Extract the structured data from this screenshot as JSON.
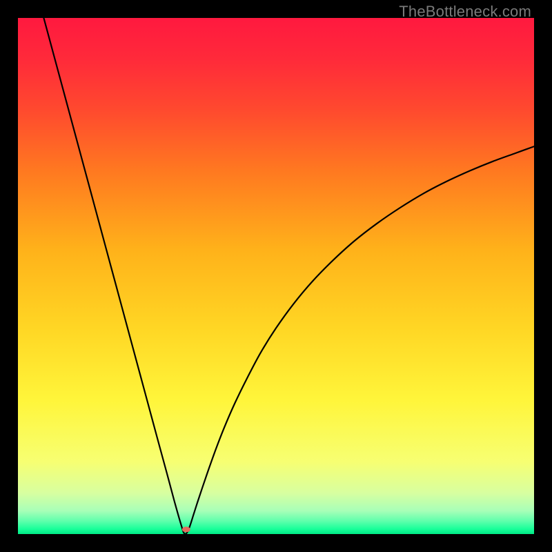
{
  "watermark": "TheBottleneck.com",
  "chart_data": {
    "type": "line",
    "title": "",
    "xlabel": "",
    "ylabel": "",
    "xlim": [
      0,
      100
    ],
    "ylim": [
      0,
      100
    ],
    "grid": false,
    "series": [
      {
        "name": "curve",
        "x": [
          5,
          7,
          9,
          11,
          13,
          15,
          17,
          19,
          21,
          23,
          25,
          27,
          28.8,
          30.3,
          31.2,
          31.8,
          32.1,
          32.45,
          32.9,
          33.4,
          34,
          34.8,
          35.8,
          37,
          38.4,
          40,
          42,
          44.4,
          47,
          50,
          53.4,
          57,
          61,
          65.2,
          69.6,
          74,
          78.6,
          83,
          87.6,
          92,
          96.4,
          100
        ],
        "y": [
          100,
          92.6,
          85.2,
          77.8,
          70.4,
          63,
          55.6,
          48.2,
          40.8,
          33.4,
          26,
          18.6,
          12,
          6.4,
          3.2,
          1.2,
          0.3,
          0.02,
          0.5,
          1.8,
          3.7,
          6.2,
          9.2,
          12.7,
          16.6,
          20.7,
          25.3,
          30.2,
          35.1,
          39.9,
          44.6,
          48.9,
          53,
          56.8,
          60.2,
          63.2,
          66,
          68.3,
          70.4,
          72.2,
          73.8,
          75.1
        ]
      }
    ],
    "marker": {
      "x": 32.6,
      "y": 0.9,
      "color": "#e46a5e",
      "rx": 6,
      "ry": 4
    },
    "gradient_stops": [
      {
        "offset": 0.0,
        "color": "#ff193f"
      },
      {
        "offset": 0.08,
        "color": "#ff2a3a"
      },
      {
        "offset": 0.18,
        "color": "#ff4a2e"
      },
      {
        "offset": 0.3,
        "color": "#ff7a20"
      },
      {
        "offset": 0.45,
        "color": "#ffb21a"
      },
      {
        "offset": 0.6,
        "color": "#ffd624"
      },
      {
        "offset": 0.74,
        "color": "#fff53a"
      },
      {
        "offset": 0.86,
        "color": "#f7ff72"
      },
      {
        "offset": 0.92,
        "color": "#d8ffa0"
      },
      {
        "offset": 0.955,
        "color": "#a8ffb8"
      },
      {
        "offset": 0.975,
        "color": "#5effac"
      },
      {
        "offset": 0.99,
        "color": "#19ff9a"
      },
      {
        "offset": 1.0,
        "color": "#00e985"
      }
    ]
  }
}
